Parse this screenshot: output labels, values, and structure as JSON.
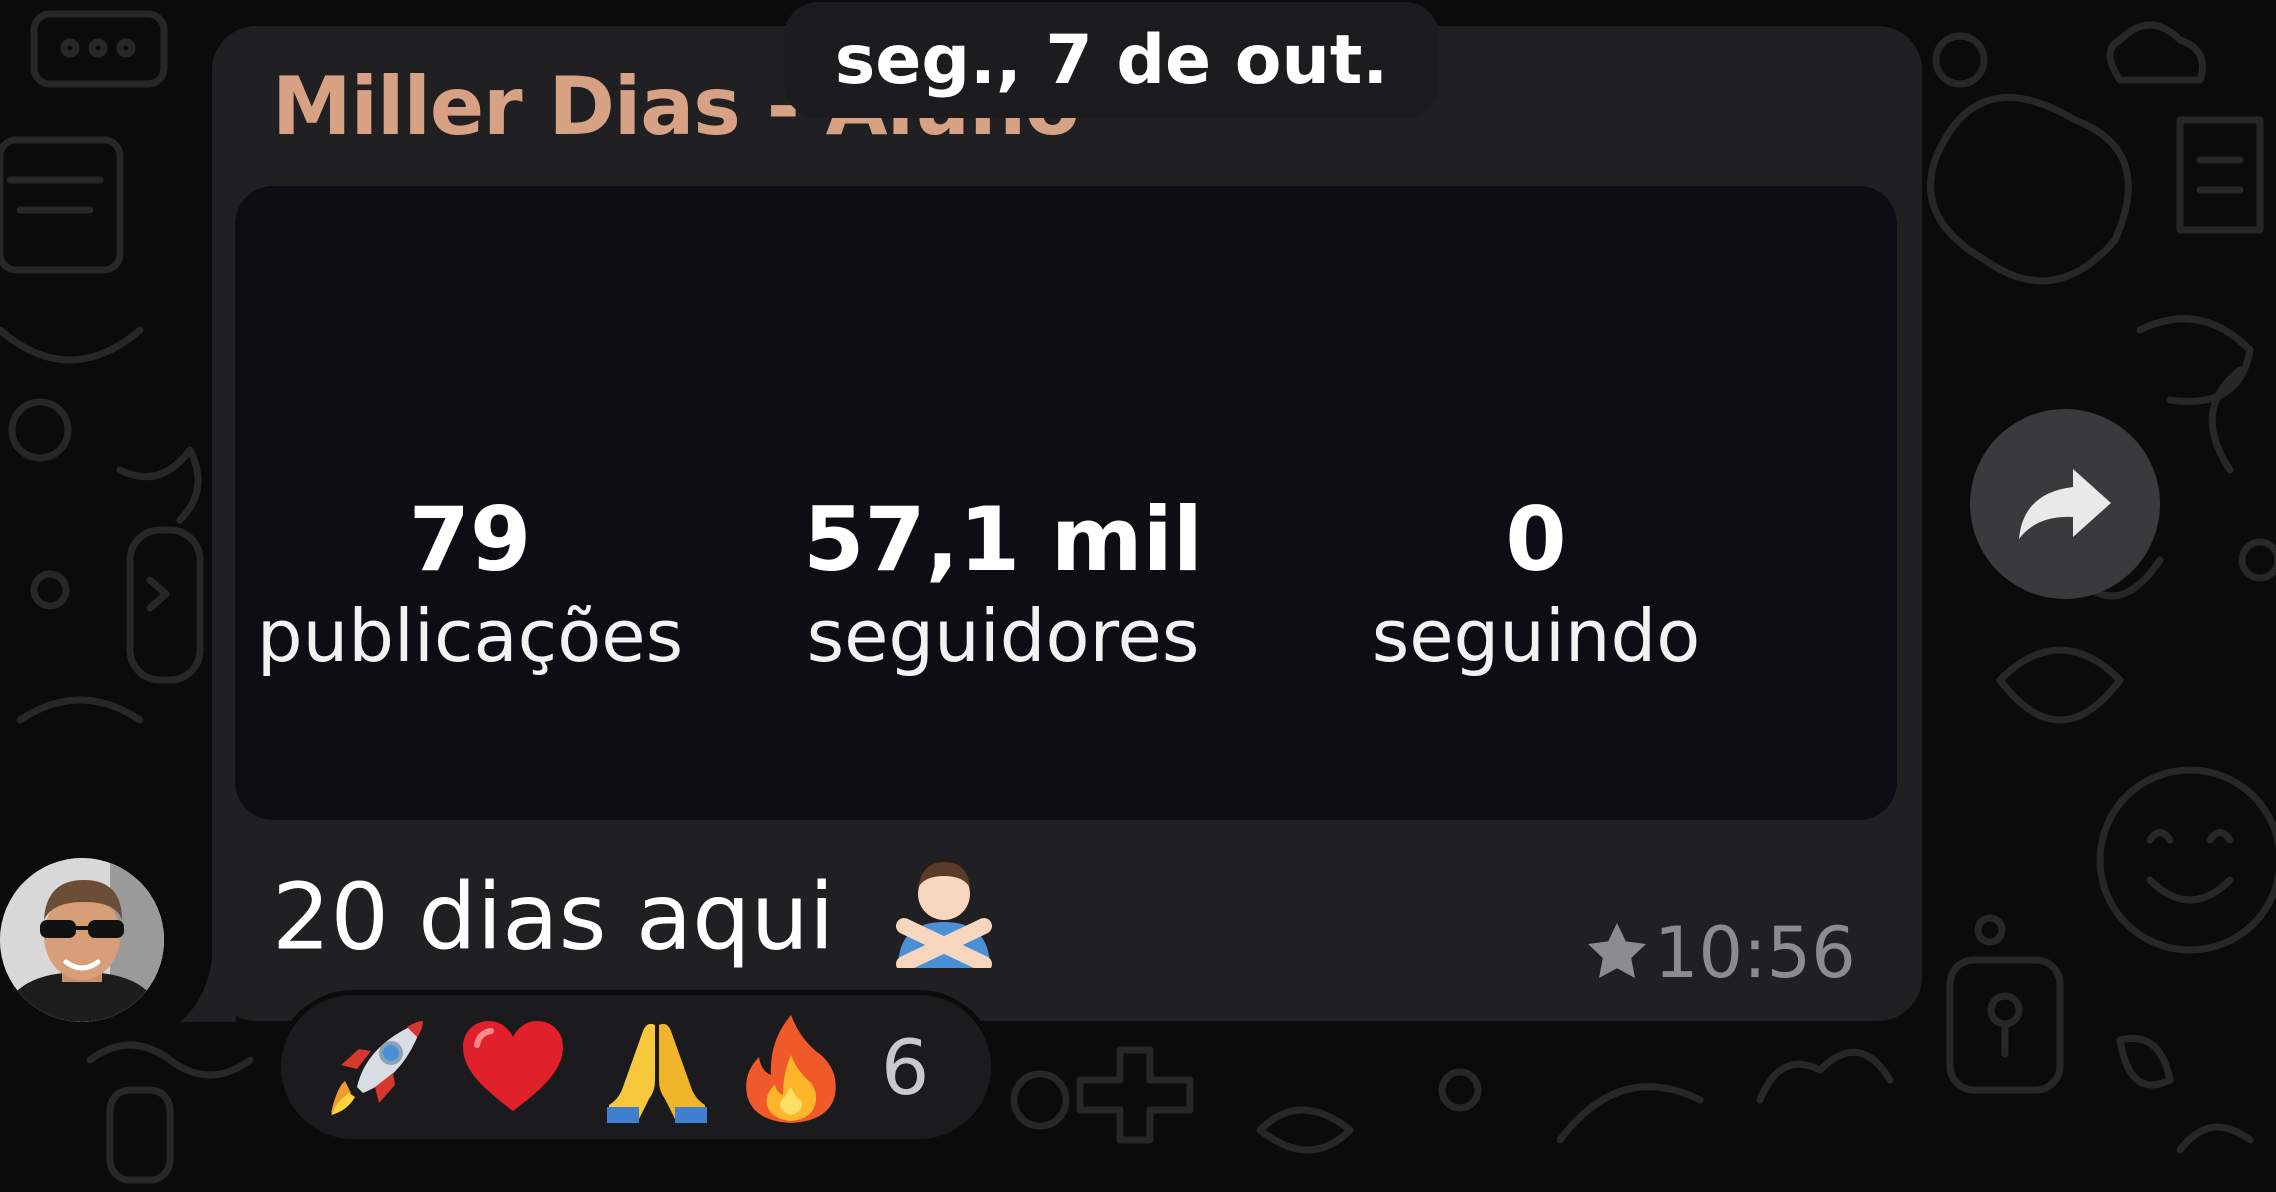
{
  "date_separator": "seg., 7 de out.",
  "message": {
    "sender_name": "Miller Dias - Aluno",
    "text": "20 dias aqui",
    "emoji": "person-gesturing-no",
    "time": "10:56",
    "starred": true,
    "icons": {
      "star": "star-icon",
      "forward": "forward-icon"
    }
  },
  "profile_stats": [
    {
      "value": "79",
      "label": "publicações"
    },
    {
      "value": "57,1 mil",
      "label": "seguidores"
    },
    {
      "value": "0",
      "label": "seguindo"
    }
  ],
  "reactions": {
    "emojis": [
      "rocket",
      "red-heart",
      "folded-hands",
      "fire"
    ],
    "count": "6"
  },
  "colors": {
    "background": "#0b0b0c",
    "bubble": "#202022",
    "sender_name": "#d7a184",
    "preview_card": "#0c0e13",
    "meta_text": "#8c8c90",
    "forward_button": "#3a3a3c"
  }
}
